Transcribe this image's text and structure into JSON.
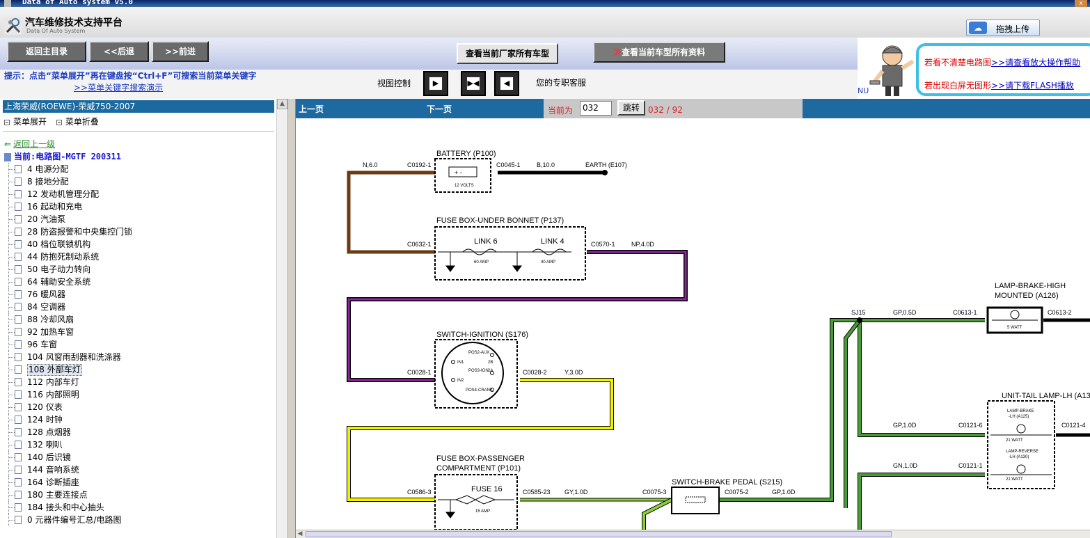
{
  "window": {
    "title": "Data of Auto system v5.0"
  },
  "header": {
    "app_title": "汽车维修技术支持平台",
    "app_subtitle": "Data Of Auto System",
    "upload_label": "拖拽上传"
  },
  "toolbar": {
    "home": "返回主目录",
    "back": "<<后退",
    "forward": ">>前进",
    "all_models": "查看当前厂家所有车型",
    "all_docs_arrow": "≫",
    "all_docs": "查看当前车型所有资料"
  },
  "hint": {
    "text": "提示：点击“菜单展开”再在键盘按“Ctrl+F”可搜索当前菜单关键字",
    "link": ">>菜单关键字搜索演示"
  },
  "view_control": {
    "label": "视图控制"
  },
  "service": {
    "text": "您的专职客服"
  },
  "help": {
    "line1_prefix": "若看不清楚电路图",
    "line1_link": ">>请查看放大操作帮助",
    "line2_prefix": "若出现白屏无图形",
    "line2_link": ">>请下载FLASH播放",
    "nu": "NU"
  },
  "left": {
    "vehicle": "上海荣威(ROEWE)-荣威750-2007",
    "expand": "菜单展开",
    "collapse": "菜单折叠",
    "back_up": "返回上一级",
    "current": "当前:电路图-MGTF 200311",
    "items": [
      {
        "label": "4 电源分配"
      },
      {
        "label": "8 接地分配"
      },
      {
        "label": "12 发动机管理分配"
      },
      {
        "label": "16 起动和充电"
      },
      {
        "label": "20 汽油泵"
      },
      {
        "label": "28 防盗报警和中央集控门锁"
      },
      {
        "label": "40 档位联锁机构"
      },
      {
        "label": "44 防抱死制动系统"
      },
      {
        "label": "50 电子动力转向"
      },
      {
        "label": "64 辅助安全系统"
      },
      {
        "label": "76 暖风器"
      },
      {
        "label": "84 空调器"
      },
      {
        "label": "88 冷却风扇"
      },
      {
        "label": "92 加热车窗"
      },
      {
        "label": "96 车窗"
      },
      {
        "label": "104 风窗雨刮器和洗涤器"
      },
      {
        "label": "108 外部车灯"
      },
      {
        "label": "112 内部车灯"
      },
      {
        "label": "116 内部照明"
      },
      {
        "label": "120 仪表"
      },
      {
        "label": "124 时钟"
      },
      {
        "label": "128 点烟器"
      },
      {
        "label": "132 喇叭"
      },
      {
        "label": "140 后识镜"
      },
      {
        "label": "144 音响系统"
      },
      {
        "label": "164 诊断插座"
      },
      {
        "label": "180 主要连接点"
      },
      {
        "label": "184 接头和中心抽头"
      },
      {
        "label": "0 元器件编号汇总/电路图"
      }
    ]
  },
  "pager": {
    "prev": "上一页",
    "next": "下一页",
    "current_label": "当前为",
    "current_value": "032",
    "go": "跳转",
    "count": "032 / 92"
  },
  "diagram": {
    "battery_title": "BATTERY (P100)",
    "battery_volts": "12 VOLTS",
    "battery_sym": "+ -",
    "w_n60": "N,6.0",
    "c0192": "C0192-1",
    "c0045": "C0045-1",
    "w_b100": "B,10.0",
    "earth": "EARTH (E107)",
    "fusebox1": "FUSE BOX-UNDER BONNET (P137)",
    "c0632": "C0632-1",
    "link6": "LINK 6",
    "link6_amp": "60 AMP",
    "link4": "LINK 4",
    "link4_amp": "40 AMP",
    "c0570": "C0570-1",
    "w_np40": "NP,4.0D",
    "switch_ign": "SWITCH-IGNITION (S176)",
    "c0028_1": "C0028-1",
    "c0028_2": "C0028-2",
    "w_y30": "Y,3.0D",
    "ign_aux": "POS2-AUX",
    "ign_in1": "IN1",
    "ign_in2": "IN2",
    "ign_ign": "POS3-IGN",
    "ign_crank": "POS4-CRANK",
    "ign_2b": "2B",
    "ign_2a": "2A",
    "fusebox2_a": "FUSE BOX-PASSENGER",
    "fusebox2_b": "COMPARTMENT (P101)",
    "c0586": "C0586-3",
    "fuse16": "FUSE 16",
    "fuse16_amp": "15 AMP",
    "c0585": "C0585-23",
    "w_gy10": "GY,1.0D",
    "c0075_3": "C0075-3",
    "switch_brake": "SWITCH-BRAKE PEDAL (S215)",
    "c0075_2": "C0075-2",
    "w_gp10": "GP,1.0D",
    "sj15": "SJ15",
    "w_gp05": "GP,0.5D",
    "c0613_1": "C0613-1",
    "lamp_high_a": "LAMP-BRAKE-HIGH",
    "lamp_high_b": "MOUNTED (A126)",
    "lamp_high_w": "5 WATT",
    "c0613_2": "C0613-2",
    "unit_tail": "UNIT-TAIL LAMP-LH (A13",
    "w_gp10b": "GP,1.0D",
    "c0121_6": "C0121-6",
    "lamp_brake_a": "LAMP-BRAKE",
    "lamp_brake_b": "-LH (A125)",
    "lamp_brake_w": "21 WATT",
    "c0121_4": "C0121-4",
    "w_gn10": "GN,1.0D",
    "c0121_1": "C0121-1",
    "lamp_rev_a": "LAMP-REVERSE",
    "lamp_rev_b": "-LH (A130)",
    "lamp_rev_w": "21 WATT"
  }
}
